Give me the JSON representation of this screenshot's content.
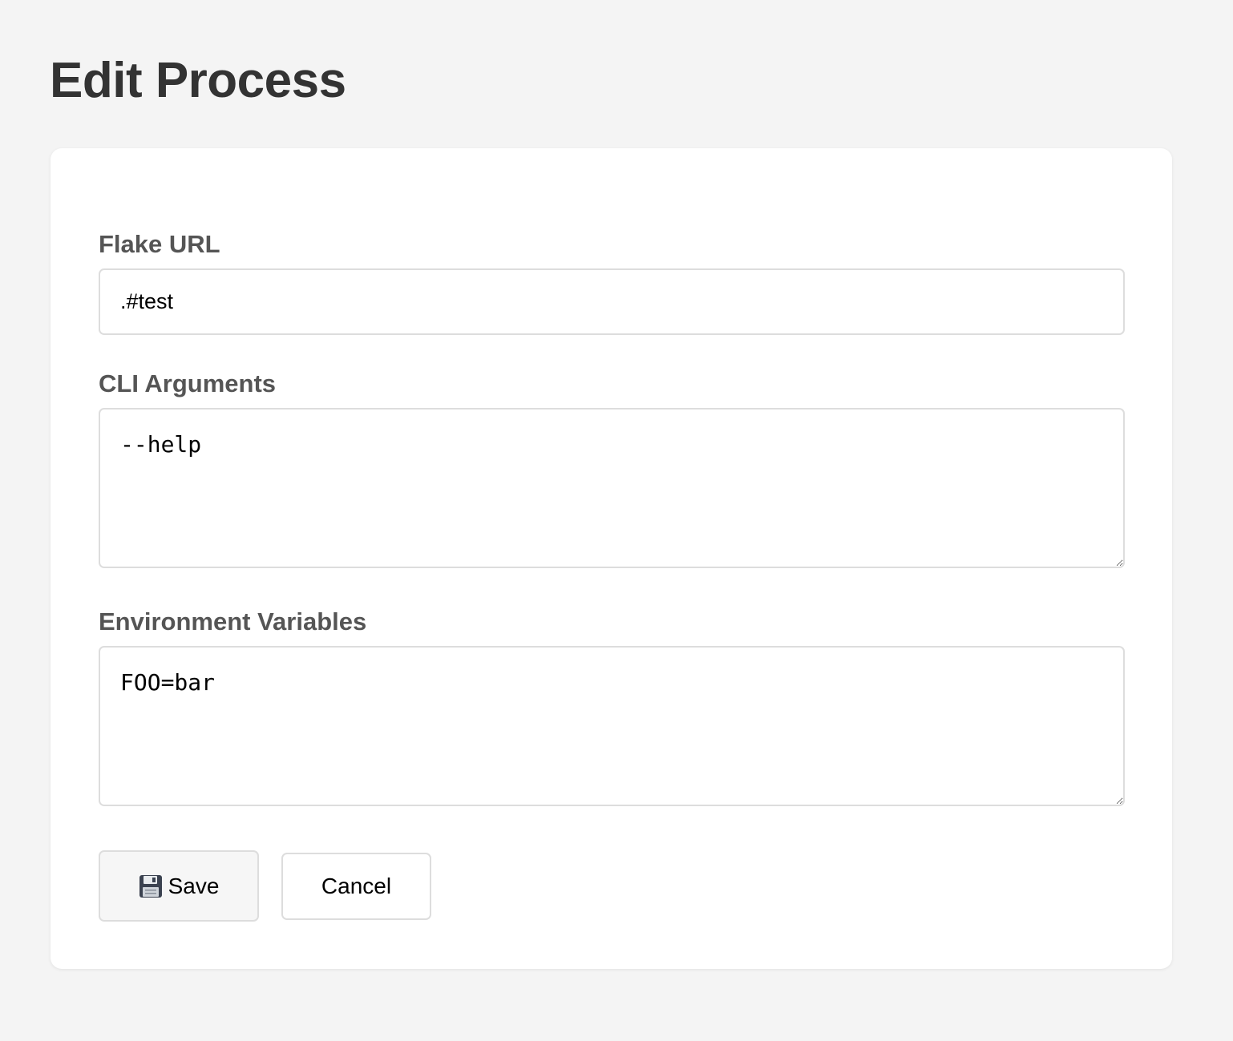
{
  "page": {
    "title": "Edit Process"
  },
  "form": {
    "flake_url": {
      "label": "Flake URL",
      "value": ".#test"
    },
    "cli_arguments": {
      "label": "CLI Arguments",
      "value": "--help"
    },
    "environment_variables": {
      "label": "Environment Variables",
      "value": "FOO=bar"
    }
  },
  "actions": {
    "save_label": "Save",
    "save_icon": "floppy-disk-icon",
    "cancel_label": "Cancel"
  }
}
